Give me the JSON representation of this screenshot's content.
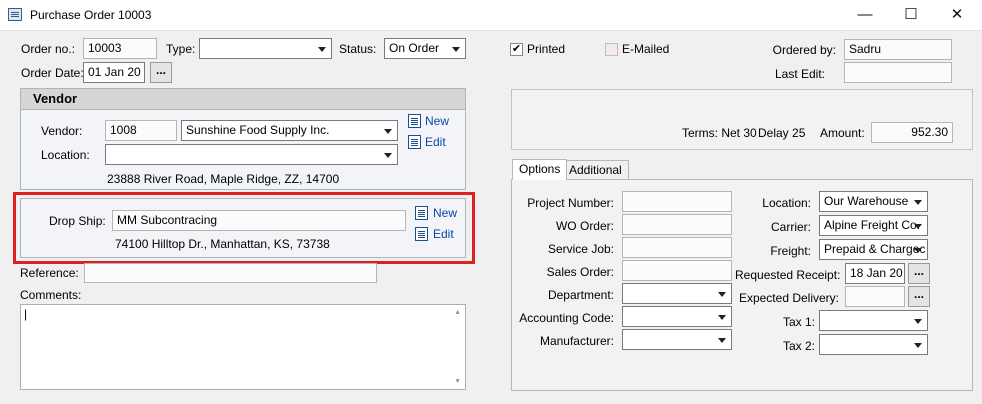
{
  "window": {
    "title": "Purchase Order 10003",
    "minimize": "—",
    "maximize": "☐",
    "close": "✕"
  },
  "header": {
    "order_no_label": "Order no.:",
    "order_no": "10003",
    "type_label": "Type:",
    "type_value": "",
    "status_label": "Status:",
    "status_value": "On Order",
    "order_date_label": "Order Date:",
    "order_date": "01 Jan 20",
    "date_btn": "...",
    "printed_label": "Printed",
    "printed_checked": "✔",
    "emailed_label": "E-Mailed",
    "ordered_by_label": "Ordered by:",
    "ordered_by": "Sadru",
    "last_edit_label": "Last Edit:",
    "last_edit": ""
  },
  "vendor": {
    "heading": "Vendor",
    "vendor_label": "Vendor:",
    "vendor_code": "1008",
    "vendor_name": "Sunshine Food Supply Inc.",
    "location_label": "Location:",
    "location_value": "",
    "address": "23888 River Road, Maple Ridge, ZZ, 14700",
    "new_link": "New",
    "edit_link": "Edit"
  },
  "dropship": {
    "label": "Drop Ship:",
    "value": "MM Subcontracing",
    "address": "74100  Hilltop Dr., Manhattan, KS, 73738",
    "new_link": "New",
    "edit_link": "Edit"
  },
  "reference": {
    "label": "Reference:",
    "value": ""
  },
  "comments": {
    "label": "Comments:",
    "value": "|",
    "scroll_up": "▲",
    "scroll_down": "▼"
  },
  "terms": {
    "terms_text": "Terms: Net 30",
    "delay_text": "Delay 25",
    "amount_label": "Amount:",
    "amount": "952.30"
  },
  "tabs": [
    {
      "label": "Options"
    },
    {
      "label": "Additional"
    }
  ],
  "options": {
    "project_number_label": "Project Number:",
    "project_number": "",
    "wo_order_label": "WO Order:",
    "wo_order": "",
    "service_job_label": "Service Job:",
    "service_job": "",
    "sales_order_label": "Sales Order:",
    "sales_order": "",
    "department_label": "Department:",
    "department": "",
    "accounting_code_label": "Accounting Code:",
    "accounting_code": "",
    "manufacturer_label": "Manufacturer:",
    "manufacturer": "",
    "location_label": "Location:",
    "location": "Our Warehouse",
    "carrier_label": "Carrier:",
    "carrier": "Alpine Freight Co.",
    "freight_label": "Freight:",
    "freight": "Prepaid & Chargec",
    "requested_receipt_label": "Requested Receipt:",
    "requested_receipt": "18 Jan 20",
    "expected_delivery_label": "Expected Delivery:",
    "expected_delivery": "",
    "tax1_label": "Tax 1:",
    "tax1": "",
    "tax2_label": "Tax 2:",
    "tax2": "",
    "date_btn": "..."
  }
}
